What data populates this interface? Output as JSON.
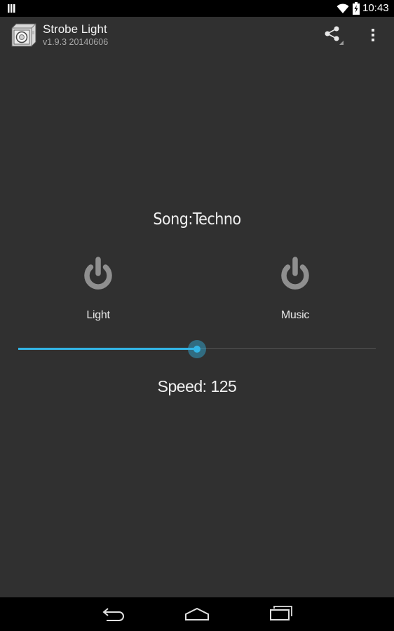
{
  "status_bar": {
    "time": "10:43",
    "icons": [
      "notification-icon",
      "wifi-icon",
      "battery-charging-icon"
    ]
  },
  "action_bar": {
    "title": "Strobe Light",
    "subtitle": "v1.9.3 20140606",
    "actions": [
      "share-icon",
      "overflow-menu-icon"
    ]
  },
  "main": {
    "song_label": "Song:Techno",
    "toggles": [
      {
        "label": "Light",
        "icon": "power-icon"
      },
      {
        "label": "Music",
        "icon": "power-icon"
      }
    ],
    "speed": {
      "label": "Speed: 125",
      "slider_fraction": 0.5
    }
  },
  "nav_bar": {
    "buttons": [
      "back-icon",
      "home-icon",
      "recent-apps-icon"
    ]
  },
  "colors": {
    "background": "#303030",
    "accent": "#33b5e5",
    "power_icon": "#8f8f8f"
  }
}
